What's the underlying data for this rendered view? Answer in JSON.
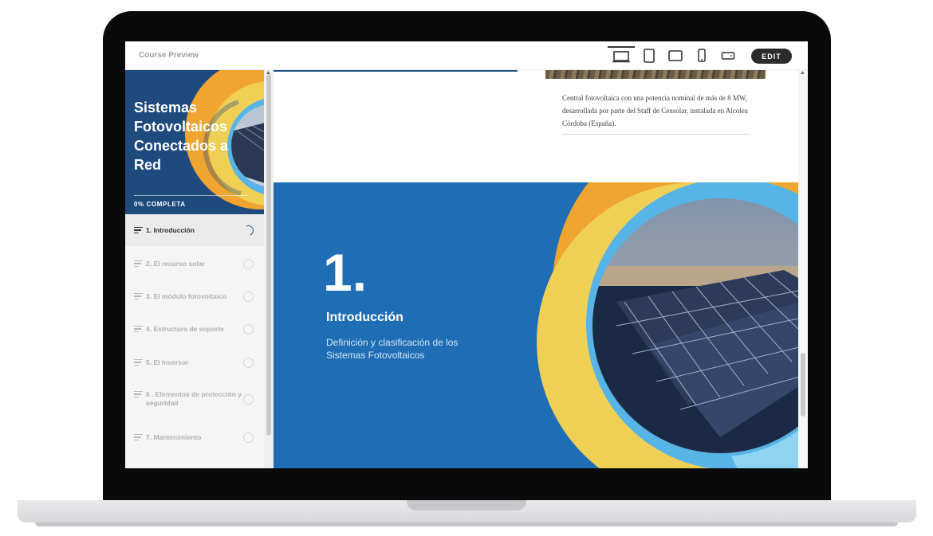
{
  "app": {
    "title": "Course Preview",
    "edit_label": "EDIT",
    "device_icons": [
      "desktop-icon",
      "tablet-portrait-icon",
      "tablet-landscape-icon",
      "phone-portrait-icon",
      "phone-landscape-icon"
    ],
    "active_device": "desktop-icon"
  },
  "course": {
    "title": "Sistemas Fotovoltaicos Conectados a Red",
    "progress_label": "0% COMPLETA",
    "progress": 0
  },
  "lessons": [
    {
      "label": "1. Introducción",
      "active": true
    },
    {
      "label": "2. El recurso solar",
      "active": false
    },
    {
      "label": "3. El módulo fotovoltaico",
      "active": false
    },
    {
      "label": "4. Estructura de soporte",
      "active": false
    },
    {
      "label": "5. El Inversor",
      "active": false
    },
    {
      "label": "6 . Elementos de protección y seguridad",
      "active": false
    },
    {
      "label": "7. Mantenimiento",
      "active": false
    }
  ],
  "content": {
    "caption": "Central fotovoltaica con una potencia nominal de más de 8 MW, desarrollada por parte del Staff de Censolar, instalada en Alcolea Córdoba (España).",
    "section_number": "1.",
    "section_title": "Introducción",
    "section_subtitle": "Definición y clasificación de los  Sistemas Fotovoltaicos"
  },
  "colors": {
    "banner_blue": "#1f6db4",
    "hero_navy": "#1e4a7e",
    "accent_yellow": "#f0cf55",
    "accent_orange": "#f1a531",
    "accent_green": "#74c84a",
    "accent_light_blue": "#56b4e7"
  }
}
